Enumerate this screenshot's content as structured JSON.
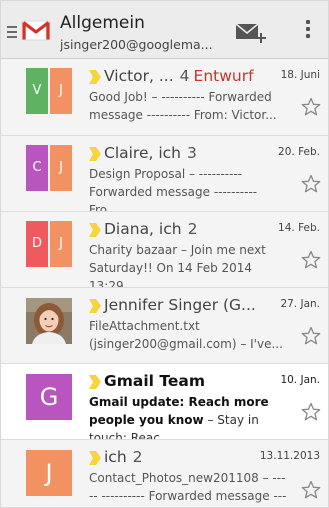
{
  "header": {
    "title": "Allgemein",
    "account": "jsinger200@googlema..."
  },
  "colors": {
    "gmail_red": "#d93025",
    "green": "#60b263",
    "orange": "#f29161",
    "purple": "#b955bf",
    "red": "#ef5a5e",
    "important": "#f5d53b"
  },
  "emails": [
    {
      "sender": "Victor, ...",
      "count": "4",
      "draft": "Entwurf",
      "date": "18. Juni",
      "snippet": "Good Job! – ---------- Forwarded message ---------- From: Victor...",
      "avatar_letters": [
        "V",
        "J"
      ],
      "avatar_colors": [
        "#60b263",
        "#f29161"
      ],
      "unread": false
    },
    {
      "sender": "Claire, ich",
      "count": "3",
      "date": "20. Feb.",
      "snippet": "Design Proposal – ---------- Forwarded message ---------- Fro...",
      "avatar_letters": [
        "C",
        "J"
      ],
      "avatar_colors": [
        "#b955bf",
        "#f29161"
      ],
      "unread": false
    },
    {
      "sender": "Diana, ich",
      "count": "2",
      "date": "14. Feb.",
      "snippet": "Charity bazaar – Join me next Saturday!! On 14 Feb 2014 13:29,...",
      "avatar_letters": [
        "D",
        "J"
      ],
      "avatar_colors": [
        "#ef5a5e",
        "#f29161"
      ],
      "unread": false
    },
    {
      "sender": "Jennifer Singer (G...",
      "date": "27. Jan.",
      "snippet": "FileAttachment.txt (jsinger200@gmail.com) – I've...",
      "avatar_photo": "woman-portrait",
      "unread": false
    },
    {
      "sender": "Gmail Team",
      "date": "10. Jan.",
      "subject": "Gmail update: Reach more people you know",
      "snippet": " – Stay in touch: Reac...",
      "avatar_letters": [
        "G"
      ],
      "avatar_colors": [
        "#b955bf"
      ],
      "unread": true
    },
    {
      "sender": "ich",
      "count": "2",
      "date": "13.11.2013",
      "snippet": "Contact_Photos_new201108 – ----- ---------- Forwarded message ----------",
      "avatar_letters": [
        "J"
      ],
      "avatar_colors": [
        "#f29161"
      ],
      "unread": false
    }
  ],
  "icons": {
    "menu": "hamburger-icon",
    "logo": "gmail-logo",
    "compose": "compose-mail-icon",
    "overflow": "overflow-menu-icon",
    "important": "importance-marker-icon",
    "star": "star-outline-icon"
  }
}
